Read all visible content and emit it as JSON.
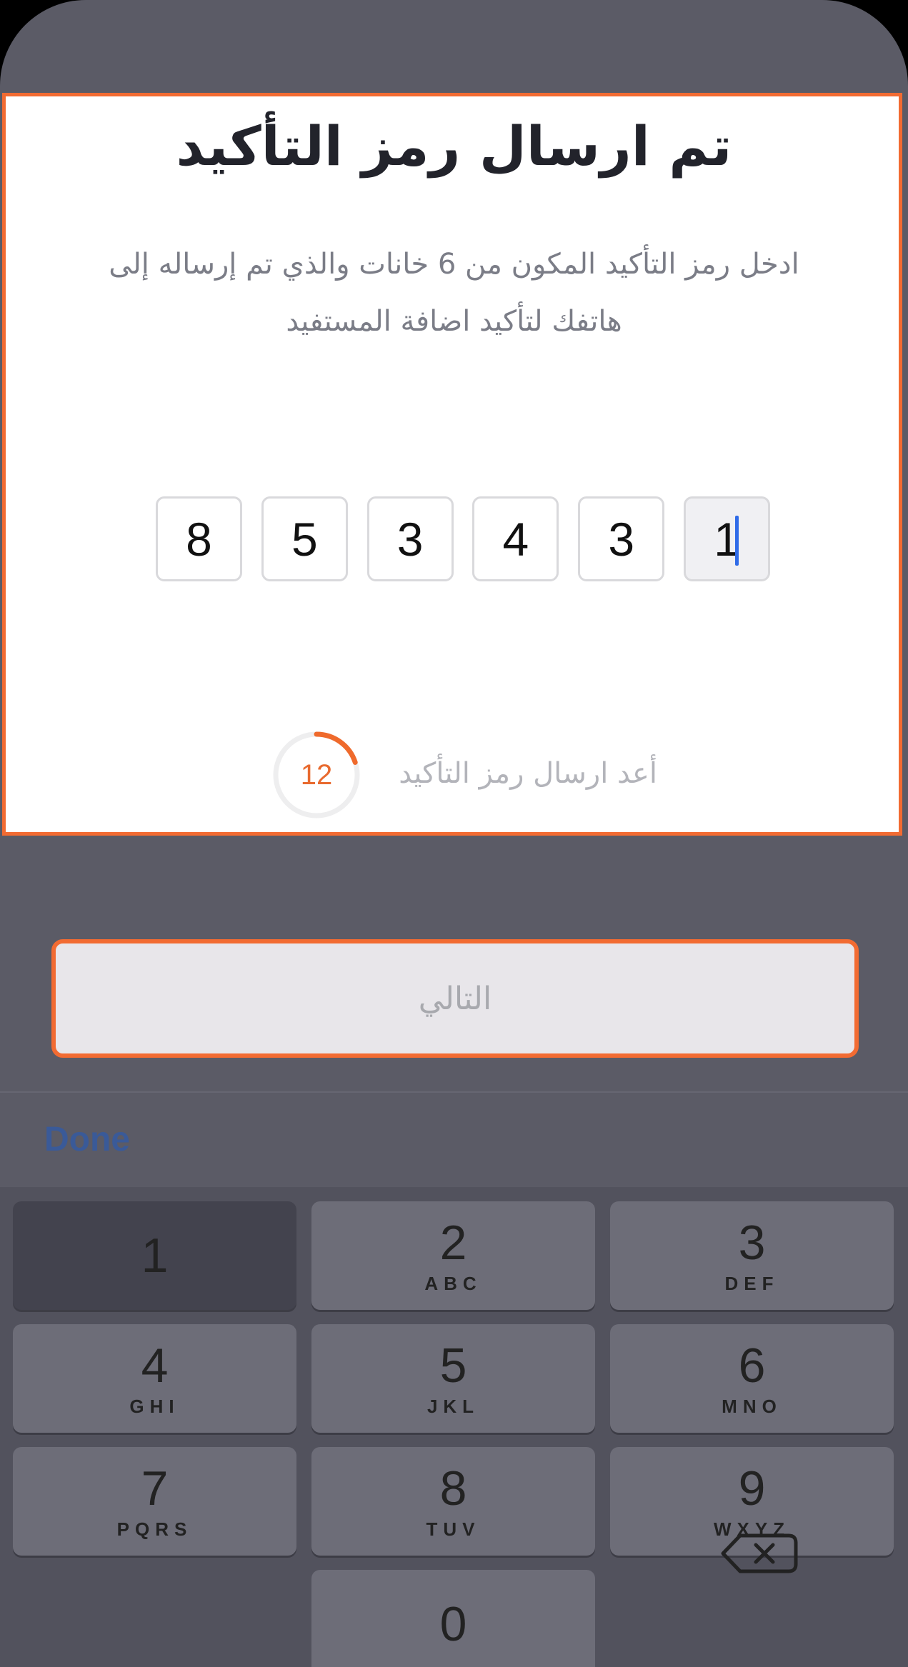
{
  "verification": {
    "title": "تم ارسال رمز التأكيد",
    "subtitle_line1": "ادخل رمز التأكيد المكون من 6 خانات والذي تم إرساله إلى",
    "subtitle_line2": "هاتفك لتأكيد اضافة المستفيد",
    "otp_digits": [
      "8",
      "5",
      "3",
      "4",
      "3",
      "1"
    ],
    "resend_label": "أعد ارسال رمز التأكيد",
    "timer_seconds": "12",
    "timer_progress": 0.2
  },
  "next_button": {
    "label": "التالي"
  },
  "keyboard": {
    "done_label": "Done",
    "keys": [
      {
        "num": "1",
        "letters": ""
      },
      {
        "num": "2",
        "letters": "ABC"
      },
      {
        "num": "3",
        "letters": "DEF"
      },
      {
        "num": "4",
        "letters": "GHI"
      },
      {
        "num": "5",
        "letters": "JKL"
      },
      {
        "num": "6",
        "letters": "MNO"
      },
      {
        "num": "7",
        "letters": "PQRS"
      },
      {
        "num": "8",
        "letters": "TUV"
      },
      {
        "num": "9",
        "letters": "WXYZ"
      },
      {
        "num": "0",
        "letters": ""
      }
    ]
  },
  "colors": {
    "accent": "#f26b32",
    "caret": "#2f6be8",
    "done": "#3a5a98"
  }
}
